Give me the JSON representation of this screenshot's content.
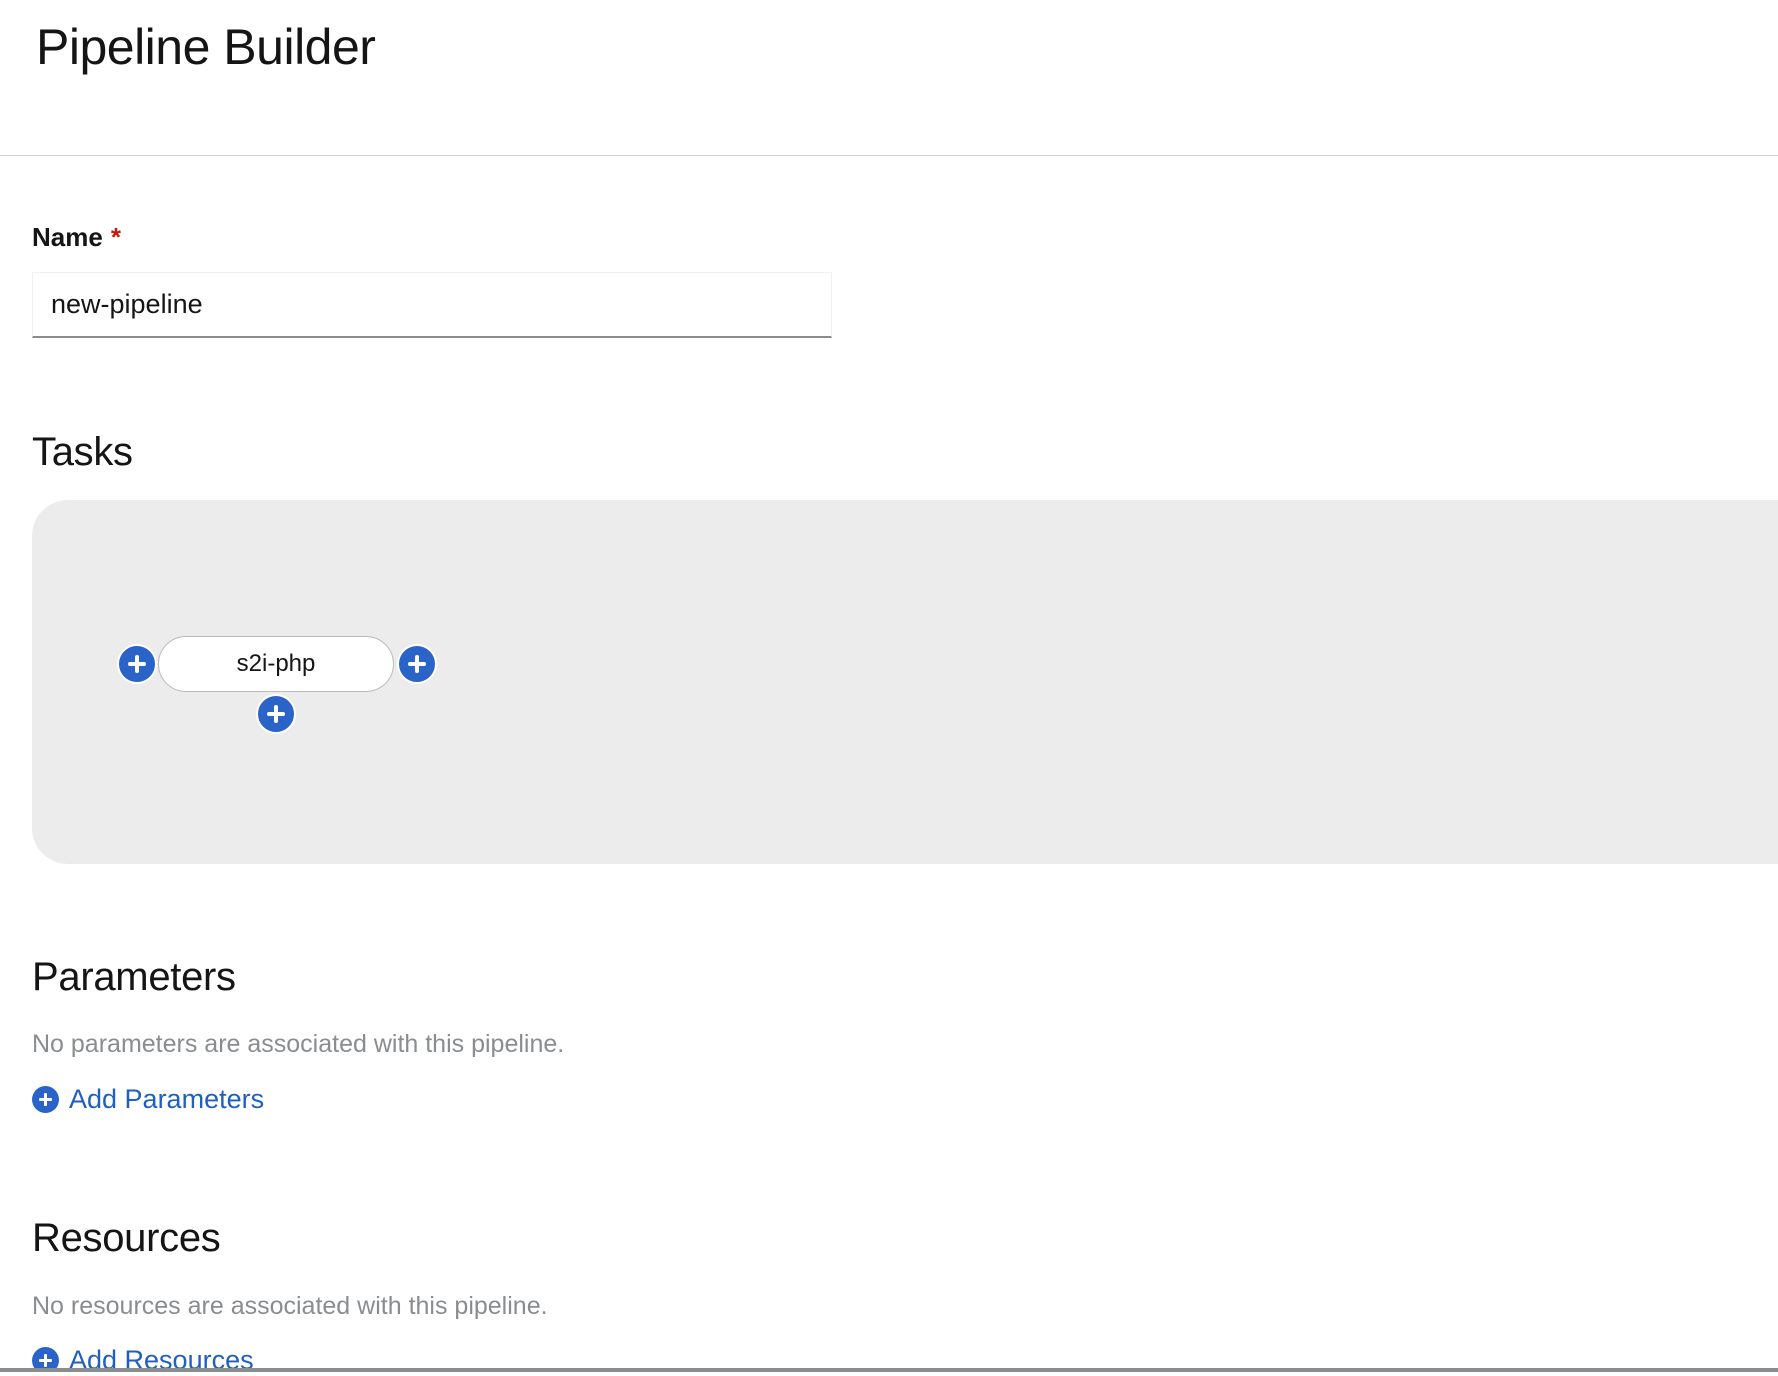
{
  "page": {
    "title": "Pipeline Builder"
  },
  "form": {
    "name_label": "Name",
    "required_marker": "*",
    "name_value": "new-pipeline"
  },
  "tasks": {
    "heading": "Tasks",
    "nodes": [
      {
        "label": "s2i-php"
      }
    ],
    "add_icon": "plus-circle-icon"
  },
  "parameters": {
    "heading": "Parameters",
    "empty_message": "No parameters are associated with this pipeline.",
    "add_label": "Add Parameters"
  },
  "resources": {
    "heading": "Resources",
    "empty_message": "No resources are associated with this pipeline.",
    "add_label": "Add Resources"
  },
  "colors": {
    "accent": "#2b64c8",
    "link": "#1f5fbf",
    "required": "#c9190b",
    "canvas": "#ececec",
    "muted_text": "#8a8d90"
  }
}
